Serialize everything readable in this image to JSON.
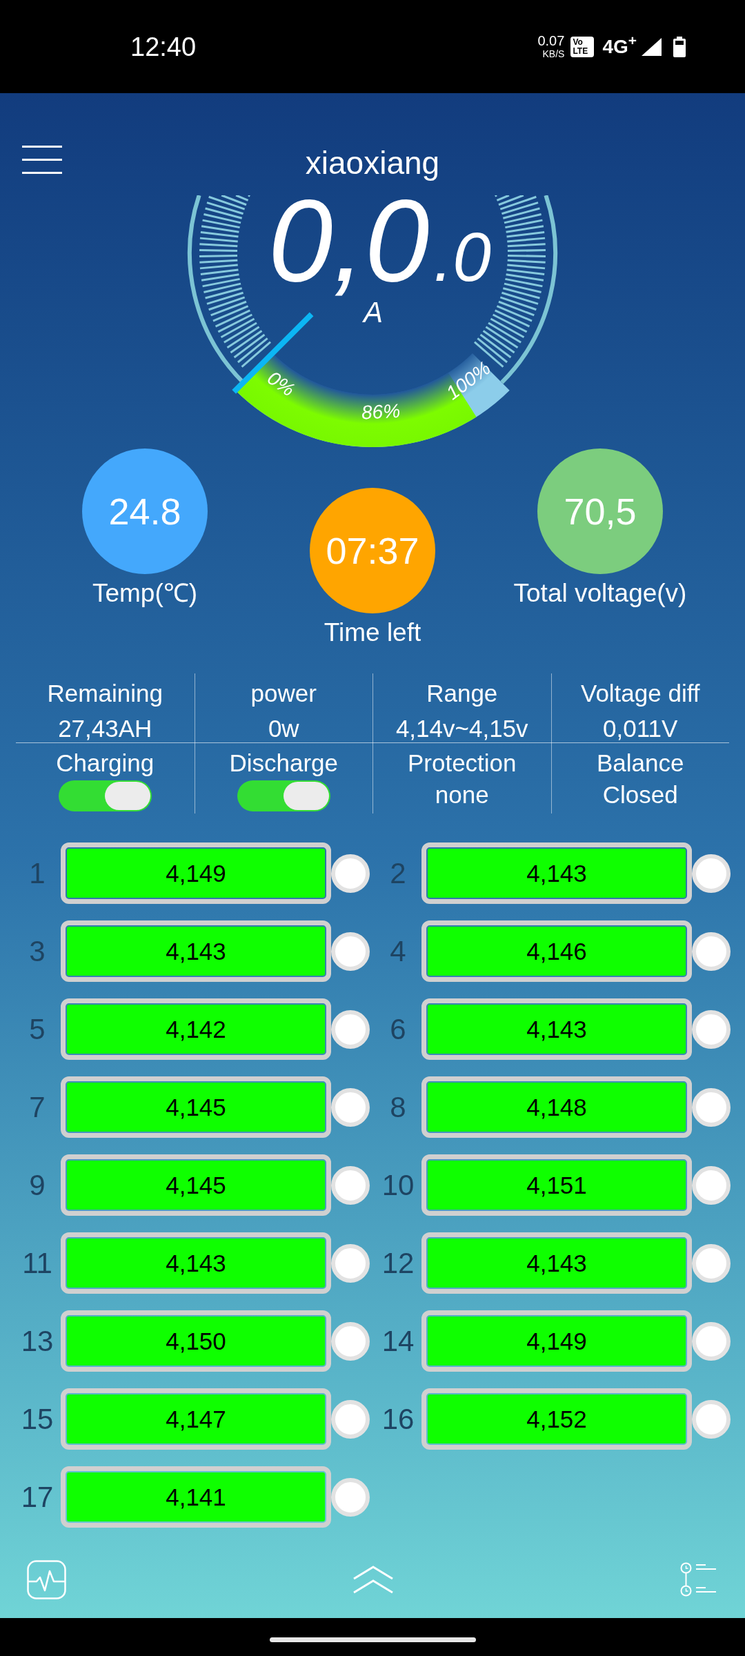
{
  "status_bar": {
    "time": "12:40",
    "net_speed": "0.07",
    "net_speed_unit": "KB/S",
    "volte": [
      "Vo",
      "LTE"
    ],
    "network": "4G$^{+}$"
  },
  "header": {
    "title": "xiaoxiang"
  },
  "gauge": {
    "value": "0,0",
    "decimal": ".0",
    "unit": "A",
    "level": 0.86,
    "scale_labels": [
      "0%",
      "86%",
      "100%"
    ]
  },
  "readings": [
    {
      "value": "24.8",
      "label": "Temp(℃)",
      "color": "#44a8fc"
    },
    {
      "value": "07:37",
      "label": "Time left",
      "color": "#ffa500"
    },
    {
      "value": "70,5",
      "label": "Total voltage(v)",
      "color": "#7ccd7e"
    }
  ],
  "stats_table": {
    "rows": [
      [
        {
          "kind": "text",
          "label": "Remaining",
          "value": "27,43AH"
        },
        {
          "kind": "text",
          "label": "power",
          "value": "0w"
        },
        {
          "kind": "text",
          "label": "Range",
          "value": "4,14v~4,15v"
        },
        {
          "kind": "text",
          "label": "Voltage diff",
          "value": "0,011V"
        }
      ],
      [
        {
          "kind": "toggle",
          "label": "Charging",
          "on": true
        },
        {
          "kind": "toggle",
          "label": "Discharge",
          "on": true
        },
        {
          "kind": "text",
          "label": "Protection",
          "value": "none"
        },
        {
          "kind": "text",
          "label": "Balance",
          "value": "Closed"
        }
      ]
    ]
  },
  "cells": [
    {
      "index": "1",
      "voltage": "4,149",
      "balancing": false
    },
    {
      "index": "2",
      "voltage": "4,143",
      "balancing": false
    },
    {
      "index": "3",
      "voltage": "4,143",
      "balancing": false
    },
    {
      "index": "4",
      "voltage": "4,146",
      "balancing": false
    },
    {
      "index": "5",
      "voltage": "4,142",
      "balancing": false
    },
    {
      "index": "6",
      "voltage": "4,143",
      "balancing": false
    },
    {
      "index": "7",
      "voltage": "4,145",
      "balancing": false
    },
    {
      "index": "8",
      "voltage": "4,148",
      "balancing": false
    },
    {
      "index": "9",
      "voltage": "4,145",
      "balancing": false
    },
    {
      "index": "10",
      "voltage": "4,151",
      "balancing": false
    },
    {
      "index": "11",
      "voltage": "4,143",
      "balancing": false
    },
    {
      "index": "12",
      "voltage": "4,143",
      "balancing": false
    },
    {
      "index": "13",
      "voltage": "4,150",
      "balancing": false
    },
    {
      "index": "14",
      "voltage": "4,149",
      "balancing": false
    },
    {
      "index": "15",
      "voltage": "4,147",
      "balancing": false
    },
    {
      "index": "16",
      "voltage": "4,152",
      "balancing": false
    },
    {
      "index": "17",
      "voltage": "4,141",
      "balancing": false
    }
  ]
}
